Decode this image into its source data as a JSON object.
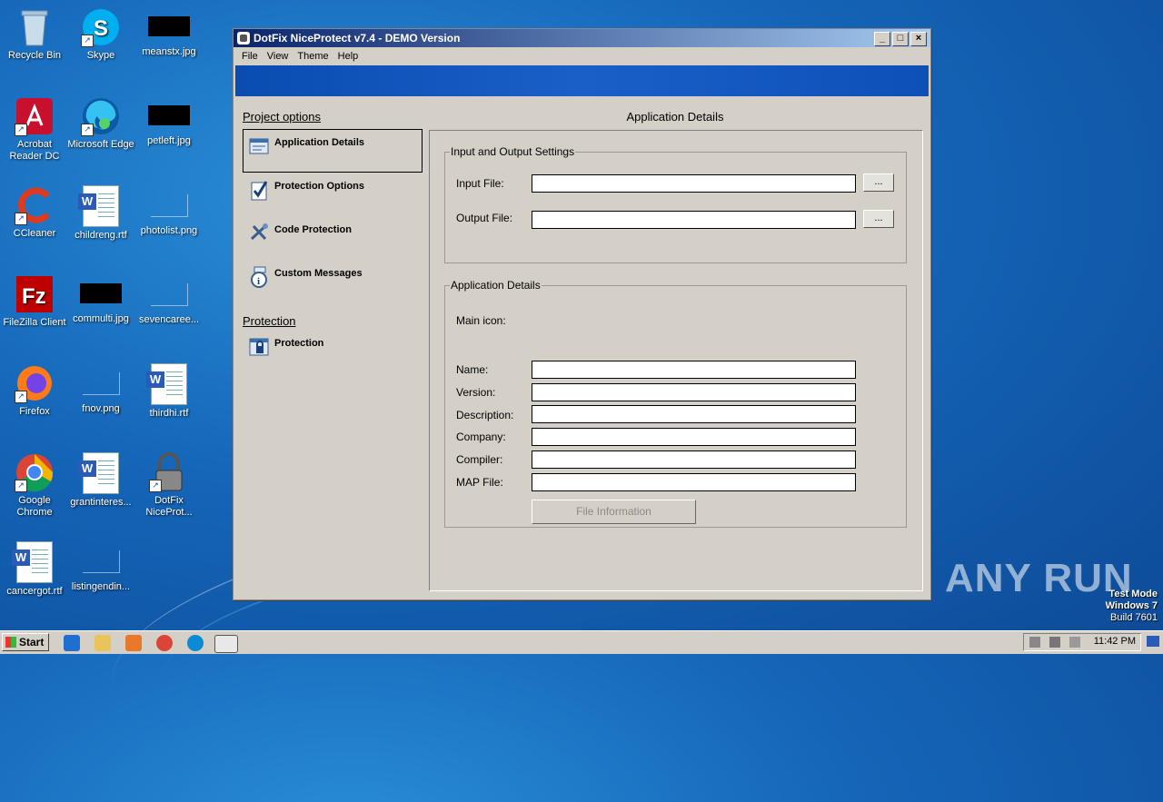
{
  "desktop": {
    "icons": [
      {
        "label": "Recycle Bin"
      },
      {
        "label": "Skype"
      },
      {
        "label": "meanstx.jpg"
      },
      {
        "label": "Acrobat Reader DC"
      },
      {
        "label": "Microsoft Edge"
      },
      {
        "label": "petleft.jpg"
      },
      {
        "label": "CCleaner"
      },
      {
        "label": "childreng.rtf"
      },
      {
        "label": "photolist.png"
      },
      {
        "label": "FileZilla Client"
      },
      {
        "label": "commulti.jpg"
      },
      {
        "label": "sevencaree..."
      },
      {
        "label": "Firefox"
      },
      {
        "label": "fnov.png"
      },
      {
        "label": "thirdhi.rtf"
      },
      {
        "label": "Google Chrome"
      },
      {
        "label": "grantinteres..."
      },
      {
        "label": "DotFix NiceProt..."
      },
      {
        "label": "cancergot.rtf"
      },
      {
        "label": "listingendin..."
      }
    ],
    "watermark": "ANY RUN",
    "testmode": {
      "line1": "Test Mode",
      "line2": "Windows 7",
      "line3": "Build 7601"
    }
  },
  "window": {
    "title": "DotFix NiceProtect v7.4 - DEMO Version",
    "controls": {
      "minimize": "_",
      "maximize": "□",
      "close": "×"
    },
    "menu": [
      "File",
      "View",
      "Theme",
      "Help"
    ],
    "left": {
      "project_header": "Project options",
      "items": [
        {
          "label": "Application Details"
        },
        {
          "label": "Protection Options"
        },
        {
          "label": "Code Protection"
        },
        {
          "label": "Custom Messages"
        }
      ],
      "protection_header": "Protection",
      "protection_items": [
        {
          "label": "Protection"
        }
      ]
    },
    "panel": {
      "title": "Application Details",
      "io_group": {
        "legend": "Input and Output Settings",
        "input_label": "Input File:",
        "input_value": "",
        "output_label": "Output File:",
        "output_value": "",
        "browse_label": "..."
      },
      "details_group": {
        "legend": "Application Details",
        "main_icon_label": "Main icon:",
        "fields": [
          {
            "label": "Name:",
            "value": ""
          },
          {
            "label": "Version:",
            "value": ""
          },
          {
            "label": "Description:",
            "value": ""
          },
          {
            "label": "Company:",
            "value": ""
          },
          {
            "label": "Compiler:",
            "value": ""
          },
          {
            "label": "MAP File:",
            "value": ""
          }
        ],
        "file_info_button": "File Information"
      }
    }
  },
  "taskbar": {
    "start_label": "Start",
    "clock": "11:42 PM"
  }
}
